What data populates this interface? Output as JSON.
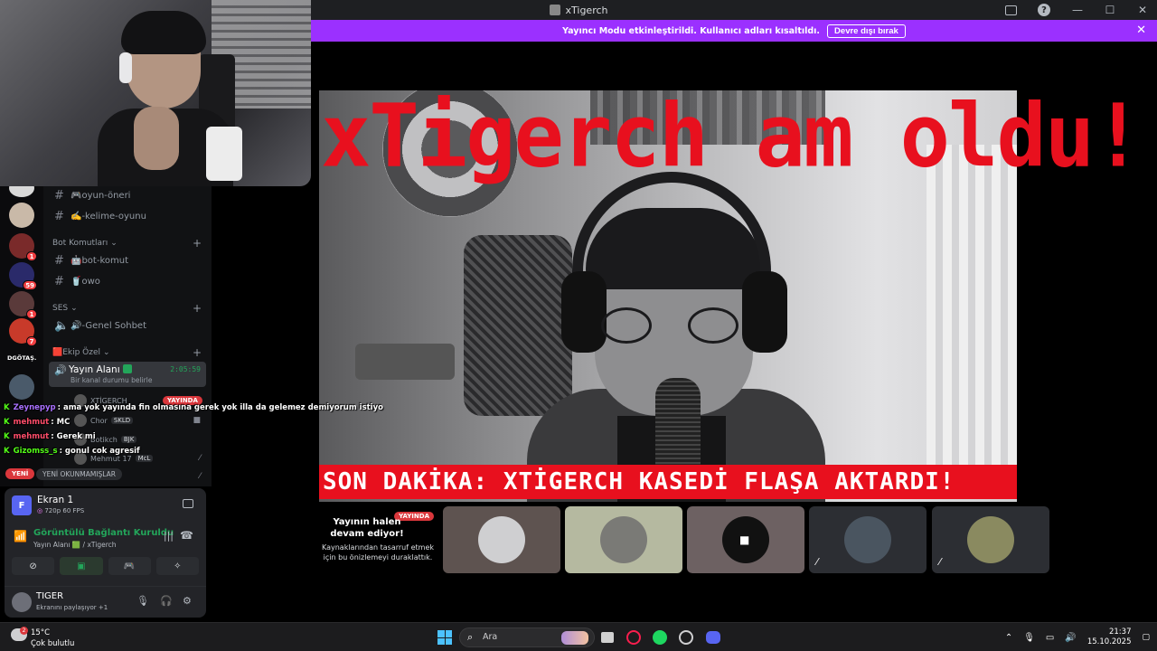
{
  "window": {
    "title": "xTigerch"
  },
  "banner": {
    "text": "Yayıncı Modu etkinleştirildi. Kullanıcı adları kısaltıldı.",
    "button": "Devre dışı bırak",
    "close": "✕"
  },
  "guilds": {
    "badges": [
      "1",
      "59",
      "1",
      "7"
    ],
    "label": "DGÖTAŞ."
  },
  "channels": {
    "items": [
      {
        "name": "🎮oyun-öneri"
      },
      {
        "name": "✍️-kelime-oyunu"
      }
    ],
    "categories": {
      "bot": "Bot Komutları",
      "ses": "SES",
      "ekip": "🟥Ekip Özel"
    },
    "bot_channels": [
      "🤖bot-komut",
      "🥤owo"
    ],
    "voice_general": "🔊-Genel Sohbet",
    "active_voice": {
      "name": "Yayın Alanı",
      "time": "2:05:59",
      "status": "Bir kanal durumu belirle"
    },
    "voice_users": [
      {
        "name": "XTİGERCH",
        "tag": ""
      },
      {
        "name": "Chor",
        "tag": "SKLD"
      },
      {
        "name": "Botikch",
        "tag": "BJK"
      },
      {
        "name": "Mehmut 17",
        "tag": "McL"
      }
    ],
    "live_label": "YAYINDA",
    "new_label": "YENİ",
    "unread_label": "YENİ OKUNMAMIŞLAR"
  },
  "chat": [
    {
      "user": "Zeynepyp",
      "text": ": ama yok yayında fin olmasına gerek yok illa da gelemez demiyorum istiyo",
      "color": "#a970ff"
    },
    {
      "user": "mehmut",
      "text": ": MC",
      "color": "#ff4d6a"
    },
    {
      "user": "mehmut",
      "text": ": Gerek mi",
      "color": "#ff4d6a"
    },
    {
      "user": "Gizomss_s",
      "text": ": gonul cok agresif",
      "color": "#53fc18"
    }
  ],
  "panel": {
    "share_title": "Ekran 1",
    "share_quality": "720p 60 FPS",
    "share_avatar": "F",
    "conn_title": "Görüntülü Bağlantı Kuruldu",
    "conn_sub": "Yayın Alanı 🟩 / xTigerch",
    "user_name": "TIGER",
    "user_status": "Ekranını paylaşıyor +1"
  },
  "stream": {
    "headline": "xTigerch am oldu!",
    "ticker": "SON DAKİKA: XTİGERCH KASEDİ FLAŞA AKTARDI!"
  },
  "paused": {
    "pill": "YAYINDA",
    "title": "Yayının halen devam ediyor!",
    "subtitle": "Kaynaklarından tasarruf etmek için bu önizlemeyi duraklattık."
  },
  "taskbar": {
    "weather_temp": "15°C",
    "weather_cond": "Çok bulutlu",
    "weather_badge": "2",
    "search": "Ara",
    "time": "21:37",
    "date": "15.10.2025"
  }
}
